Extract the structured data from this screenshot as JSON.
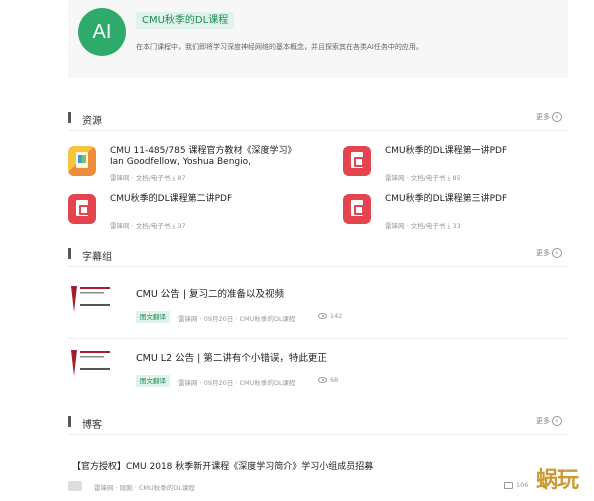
{
  "course": {
    "avatar_text": "AI",
    "tag": "CMU秋季的DL课程",
    "desc": "在本门课程中，我们即将学习深度神经网络的基本概念，并且探索其在各类AI任务中的应用。"
  },
  "sections": {
    "resources": {
      "title": "资源",
      "more": "更多"
    },
    "subtitles": {
      "title": "字幕组",
      "more": "更多"
    },
    "blog": {
      "title": "博客",
      "more": "更多"
    }
  },
  "resources": [
    {
      "title": "CMU 11-485/785 课程官方教材《深度学习》Ian Goodfellow, Yoshua Bengio,",
      "meta": "雷锋网 · 文档/电子书 ⤓ 87",
      "icon": "colorful-doc-icon"
    },
    {
      "title": "CMU秋季的DL课程第一讲PDF",
      "meta": "雷锋网 · 文档/电子书 ⤓ 85",
      "icon": "pdf-icon"
    },
    {
      "title": "CMU秋季的DL课程第二讲PDF",
      "meta": "雷锋网 · 文档/电子书 ⤓ 37",
      "icon": "pdf-icon"
    },
    {
      "title": "CMU秋季的DL课程第三讲PDF",
      "meta": "雷锋网 · 文档/电子书 ⤓ 33",
      "icon": "pdf-icon"
    }
  ],
  "subtitle_items": [
    {
      "title": "CMU 公告 | 复习二的准备以及视频",
      "tag": "图文翻译",
      "meta": "雷锋网 · 09月20日 · CMU秋季的DL课程",
      "views": "142"
    },
    {
      "title": "CMU L2 公告 | 第二讲有个小错误，特此更正",
      "tag": "图文翻译",
      "meta": "雷锋网 · 09月20日 · CMU秋季的DL课程",
      "views": "68"
    }
  ],
  "blog": {
    "title": "【官方授权】CMU 2018 秋季新开课程《深度学习简介》学习小组成员招募",
    "meta": "雷锋网 · 刚刚 · CMU秋季的DL课程",
    "comments": "106"
  },
  "watermark": "蜗玩"
}
